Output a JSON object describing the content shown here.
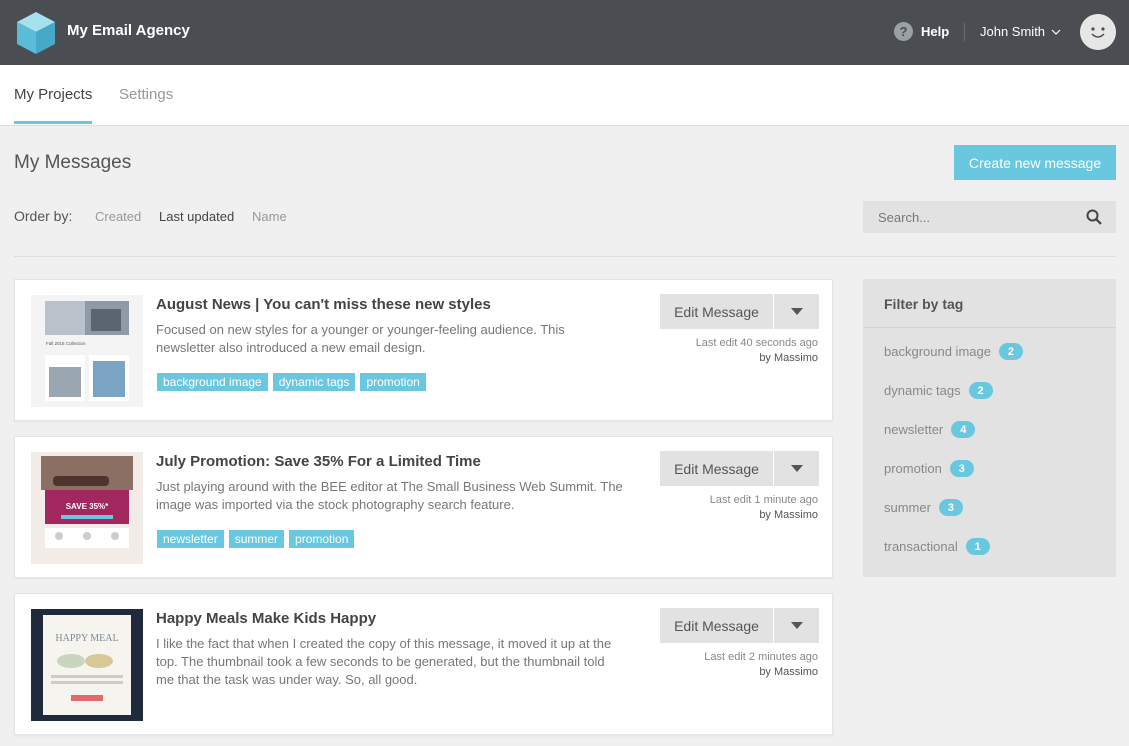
{
  "app": {
    "brand": "My Email Agency"
  },
  "header": {
    "help_label": "Help",
    "user_name": "John Smith"
  },
  "nav": {
    "tabs": [
      {
        "label": "My Projects"
      },
      {
        "label": "Settings"
      }
    ]
  },
  "page": {
    "title": "My Messages",
    "create_label": "Create new message"
  },
  "order": {
    "label": "Order by:",
    "options": [
      "Created",
      "Last updated",
      "Name"
    ],
    "selected": "Last updated"
  },
  "search": {
    "placeholder": "Search..."
  },
  "messages": [
    {
      "title": "August News | You can't miss these new styles",
      "description": "Focused on new styles for a younger or younger-feeling audience. This newsletter also introduced a new email design.",
      "tags": [
        "background image",
        "dynamic tags",
        "promotion"
      ],
      "edit_label": "Edit Message",
      "last_edit": "Last edit 40 seconds ago",
      "by": "by Massimo",
      "thumb_text": "Fall 2016 Collection"
    },
    {
      "title": "July Promotion: Save 35% For a Limited Time",
      "description": "Just playing around with the BEE editor at The Small Business Web Summit. The image was imported via the stock photography search feature.",
      "tags": [
        "newsletter",
        "summer",
        "promotion"
      ],
      "edit_label": "Edit Message",
      "last_edit": "Last edit 1 minute ago",
      "by": "by Massimo",
      "thumb_text": "SAVE 35%*"
    },
    {
      "title": "Happy Meals Make Kids Happy",
      "description": "I like the fact that when I created the copy of this message, it moved it up at the top. The thumbnail took a few seconds to be generated, but the thumbnail told me that the task was under way. So, all good.",
      "tags": [],
      "edit_label": "Edit Message",
      "last_edit": "Last edit 2 minutes ago",
      "by": "by Massimo",
      "thumb_text": "HAPPY MEAL"
    }
  ],
  "filter": {
    "title": "Filter by tag",
    "tags": [
      {
        "name": "background image",
        "count": "2"
      },
      {
        "name": "dynamic tags",
        "count": "2"
      },
      {
        "name": "newsletter",
        "count": "4"
      },
      {
        "name": "promotion",
        "count": "3"
      },
      {
        "name": "summer",
        "count": "3"
      },
      {
        "name": "transactional",
        "count": "1"
      }
    ]
  },
  "colors": {
    "topbar": "#4a4e53",
    "accent": "#6ac7e0",
    "background": "#f0f0f0",
    "panel": "#e2e2e2"
  }
}
